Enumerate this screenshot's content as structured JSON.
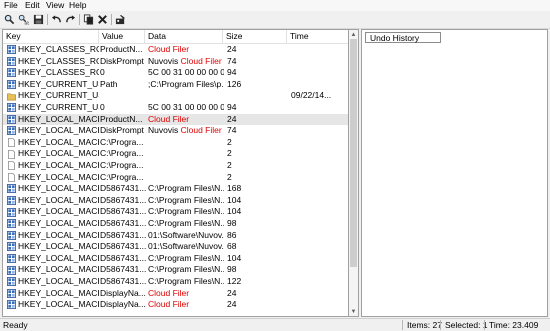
{
  "menu": [
    "File",
    "Edit",
    "View",
    "Help"
  ],
  "toolbar": [
    {
      "name": "find-icon"
    },
    {
      "name": "find-next-icon"
    },
    {
      "name": "save-icon"
    },
    {
      "name": "undo-icon"
    },
    {
      "name": "redo-icon"
    },
    {
      "name": "copy-icon"
    },
    {
      "name": "delete-icon"
    },
    {
      "name": "fix-icon"
    }
  ],
  "columns": {
    "key": "Key",
    "value": "Value",
    "data": "Data",
    "size": "Size",
    "time": "Time"
  },
  "rows": [
    {
      "icon": "reg",
      "key": "HKEY_CLASSES_ROOT...",
      "value": "ProductN...",
      "data": "Cloud Filer",
      "data_red": "",
      "data_red_flag": true,
      "size": "24",
      "time": ""
    },
    {
      "icon": "reg",
      "key": "HKEY_CLASSES_ROOT...",
      "value": "DiskPrompt",
      "data": "Nuvovis ",
      "data_red": "Cloud Filer ...",
      "size": "74",
      "time": ""
    },
    {
      "icon": "reg",
      "key": "HKEY_CLASSES_ROOT...",
      "value": "0",
      "data": "5C 00 31 00 00 00 00...",
      "data_red": "",
      "size": "94",
      "time": ""
    },
    {
      "icon": "reg",
      "key": "HKEY_CURRENT_USER...",
      "value": "Path",
      "data": ";C:\\Program Files\\p...",
      "data_red": "",
      "size": "126",
      "time": ""
    },
    {
      "icon": "folder",
      "key": "HKEY_CURRENT_USER...",
      "value": "",
      "data": "",
      "data_red": "",
      "size": "",
      "time": "09/22/14..."
    },
    {
      "icon": "reg",
      "key": "HKEY_CURRENT_USER...",
      "value": "0",
      "data": "5C 00 31 00 00 00 00...",
      "data_red": "",
      "size": "94",
      "time": ""
    },
    {
      "icon": "reg",
      "key": "HKEY_LOCAL_MACHI...",
      "value": "ProductN...",
      "data": "Cloud Filer",
      "data_red": "",
      "data_red_flag": true,
      "size": "24",
      "time": "",
      "selected": true
    },
    {
      "icon": "reg",
      "key": "HKEY_LOCAL_MACHI...",
      "value": "DiskPrompt",
      "data": "Nuvovis ",
      "data_red": "Cloud Filer ...",
      "size": "74",
      "time": ""
    },
    {
      "icon": "file",
      "key": "HKEY_LOCAL_MACHI...",
      "value": "C:\\Progra...",
      "data": "",
      "data_red": "",
      "size": "2",
      "time": ""
    },
    {
      "icon": "file",
      "key": "HKEY_LOCAL_MACHI...",
      "value": "C:\\Progra...",
      "data": "",
      "data_red": "",
      "size": "2",
      "time": ""
    },
    {
      "icon": "file",
      "key": "HKEY_LOCAL_MACHI...",
      "value": "C:\\Progra...",
      "data": "",
      "data_red": "",
      "size": "2",
      "time": ""
    },
    {
      "icon": "file",
      "key": "HKEY_LOCAL_MACHI...",
      "value": "C:\\Progra...",
      "data": "",
      "data_red": "",
      "size": "2",
      "time": ""
    },
    {
      "icon": "reg",
      "key": "HKEY_LOCAL_MACHI...",
      "value": "D5867431...",
      "data": "C:\\Program Files\\N...",
      "data_red": "",
      "size": "168",
      "time": ""
    },
    {
      "icon": "reg",
      "key": "HKEY_LOCAL_MACHI...",
      "value": "D5867431...",
      "data": "C:\\Program Files\\N...",
      "data_red": "",
      "size": "104",
      "time": ""
    },
    {
      "icon": "reg",
      "key": "HKEY_LOCAL_MACHI...",
      "value": "D5867431...",
      "data": "C:\\Program Files\\N...",
      "data_red": "",
      "size": "104",
      "time": ""
    },
    {
      "icon": "reg",
      "key": "HKEY_LOCAL_MACHI...",
      "value": "D5867431...",
      "data": "C:\\Program Files\\N...",
      "data_red": "",
      "size": "98",
      "time": ""
    },
    {
      "icon": "reg",
      "key": "HKEY_LOCAL_MACHI...",
      "value": "D5867431...",
      "data": "01:\\Software\\Nuvov...",
      "data_red": "",
      "size": "86",
      "time": ""
    },
    {
      "icon": "reg",
      "key": "HKEY_LOCAL_MACHI...",
      "value": "D5867431...",
      "data": "01:\\Software\\Nuvov...",
      "data_red": "",
      "size": "68",
      "time": ""
    },
    {
      "icon": "reg",
      "key": "HKEY_LOCAL_MACHI...",
      "value": "D5867431...",
      "data": "C:\\Program Files\\N...",
      "data_red": "",
      "size": "104",
      "time": ""
    },
    {
      "icon": "reg",
      "key": "HKEY_LOCAL_MACHI...",
      "value": "D5867431...",
      "data": "C:\\Program Files\\N...",
      "data_red": "",
      "size": "98",
      "time": ""
    },
    {
      "icon": "reg",
      "key": "HKEY_LOCAL_MACHI...",
      "value": "D5867431...",
      "data": "C:\\Program Files\\N...",
      "data_red": "",
      "size": "122",
      "time": ""
    },
    {
      "icon": "reg",
      "key": "HKEY_LOCAL_MACHI...",
      "value": "DisplayNa...",
      "data": "Cloud Filer",
      "data_red": "",
      "data_red_flag": true,
      "size": "24",
      "time": ""
    },
    {
      "icon": "reg",
      "key": "HKEY_LOCAL_MACHI...",
      "value": "DisplayNa...",
      "data": "Cloud Filer",
      "data_red": "",
      "data_red_flag": true,
      "size": "24",
      "time": ""
    }
  ],
  "undo": {
    "header": "Undo History"
  },
  "status": {
    "ready": "Ready",
    "items": "Items: 27",
    "selected": "Selected: 1",
    "time": "Time: 23.409"
  },
  "colors": {
    "highlight": "#e00000",
    "selection": "#e6e6e6"
  }
}
